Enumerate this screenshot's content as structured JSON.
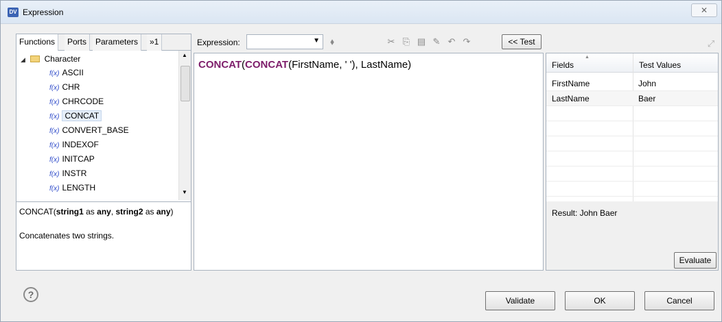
{
  "window": {
    "title": "Expression",
    "app_icon": "DV",
    "close_glyph": "✕"
  },
  "tabs": [
    {
      "label": "Functions"
    },
    {
      "label": "Ports"
    },
    {
      "label": "Parameters"
    },
    {
      "label": "»1"
    }
  ],
  "tree": {
    "group": "Character",
    "fx_glyph": "f(x)",
    "items": [
      "ASCII",
      "CHR",
      "CHRCODE",
      "CONCAT",
      "CONVERT_BASE",
      "INDEXOF",
      "INITCAP",
      "INSTR",
      "LENGTH"
    ],
    "selected": "CONCAT"
  },
  "help": {
    "fn": "CONCAT(",
    "arg1": "string1",
    "as1": " as ",
    "type1": "any",
    "sep": ", ",
    "arg2": "string2",
    "as2": " as ",
    "type2": "any",
    "close": ")",
    "description": "Concatenates two strings."
  },
  "expression": {
    "label": "Expression:",
    "select_value": "",
    "test_button": "<< Test",
    "code": {
      "outer_fn": "CONCAT",
      "p1": "(",
      "inner_fn": "CONCAT",
      "p2": "(FirstName, ' '), LastName)"
    }
  },
  "test_grid": {
    "headers": [
      "Fields",
      "Test Values"
    ],
    "rows": [
      {
        "field": "FirstName",
        "value": "John"
      },
      {
        "field": "LastName",
        "value": "Baer"
      }
    ],
    "result": "Result: John Baer",
    "evaluate_button": "Evaluate"
  },
  "footer": {
    "help_glyph": "?",
    "validate": "Validate",
    "ok": "OK",
    "cancel": "Cancel"
  }
}
